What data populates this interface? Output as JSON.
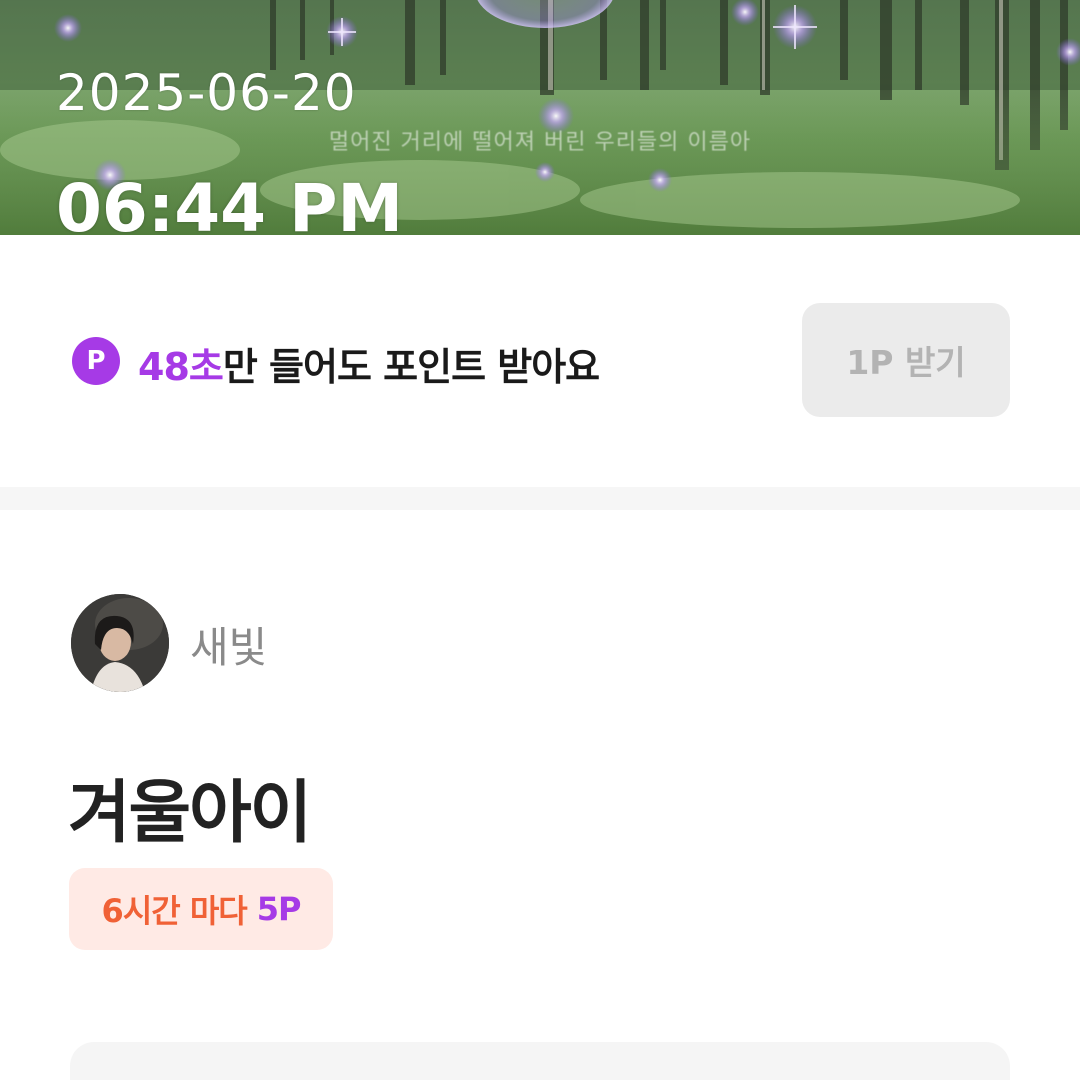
{
  "overlay": {
    "date": "2025-06-20",
    "time": "06:44 PM"
  },
  "player": {
    "lyric_line": "멀어진 거리에 떨어져 버린 우리들의 이름아"
  },
  "point_banner": {
    "badge": "P",
    "seconds": "48초",
    "message": "만 들어도 포인트 받아요",
    "claim_button": "1P 받기"
  },
  "song": {
    "artist": "새빛",
    "title": "겨울아이",
    "reward_interval": "6시간 마다",
    "reward_points": "5P"
  },
  "colors": {
    "accent_purple": "#a63ae6",
    "reward_orange": "#f06136",
    "reward_bg": "#ffeae5",
    "button_disabled_bg": "#ebebeb",
    "button_disabled_text": "#b3b3b3"
  }
}
